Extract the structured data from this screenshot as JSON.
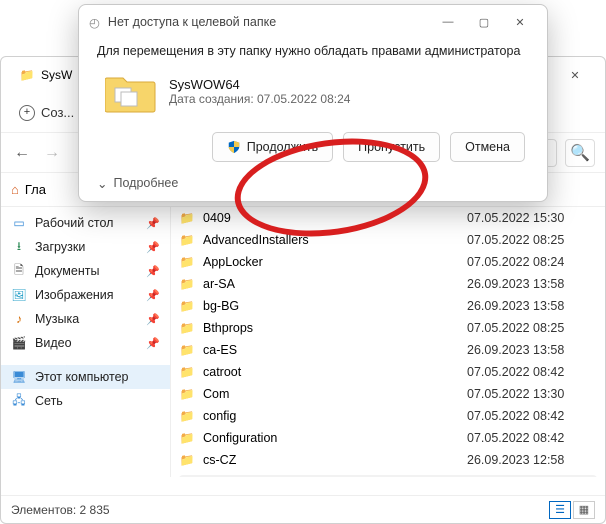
{
  "explorer": {
    "tab_title": "SysW",
    "new_button": "Соз...",
    "breadcrumb_home": "Гла",
    "search_placeholder": "",
    "sidebar": [
      {
        "label": "Рабочий стол",
        "icon": "desktop",
        "pinned": true
      },
      {
        "label": "Загрузки",
        "icon": "download",
        "pinned": true
      },
      {
        "label": "Документы",
        "icon": "document",
        "pinned": true
      },
      {
        "label": "Изображения",
        "icon": "picture",
        "pinned": true
      },
      {
        "label": "Музыка",
        "icon": "music",
        "pinned": true
      },
      {
        "label": "Видео",
        "icon": "video",
        "pinned": true
      }
    ],
    "sidebar_bottom": [
      {
        "label": "Этот компьютер",
        "icon": "pc",
        "selected": true
      },
      {
        "label": "Сеть",
        "icon": "network",
        "selected": false
      }
    ],
    "files": [
      {
        "name": "0409",
        "date": "07.05.2022 15:30"
      },
      {
        "name": "AdvancedInstallers",
        "date": "07.05.2022 08:25"
      },
      {
        "name": "AppLocker",
        "date": "07.05.2022 08:24"
      },
      {
        "name": "ar-SA",
        "date": "26.09.2023 13:58"
      },
      {
        "name": "bg-BG",
        "date": "26.09.2023 13:58"
      },
      {
        "name": "Bthprops",
        "date": "07.05.2022 08:25"
      },
      {
        "name": "ca-ES",
        "date": "26.09.2023 13:58"
      },
      {
        "name": "catroot",
        "date": "07.05.2022 08:42"
      },
      {
        "name": "Com",
        "date": "07.05.2022 13:30"
      },
      {
        "name": "config",
        "date": "07.05.2022 08:42"
      },
      {
        "name": "Configuration",
        "date": "07.05.2022 08:42"
      },
      {
        "name": "cs-CZ",
        "date": "26.09.2023 12:58"
      }
    ],
    "status": {
      "label": "Элементов:",
      "count": "2 835"
    }
  },
  "dialog": {
    "title": "Нет доступа к целевой папке",
    "message": "Для перемещения в эту папку нужно обладать правами администратора",
    "folder_name": "SysWOW64",
    "folder_date_label": "Дата создания:",
    "folder_date": "07.05.2022 08:24",
    "buttons": {
      "continue": "Продолжить",
      "skip": "Пропустить",
      "cancel": "Отмена"
    },
    "more": "Подробнее"
  }
}
